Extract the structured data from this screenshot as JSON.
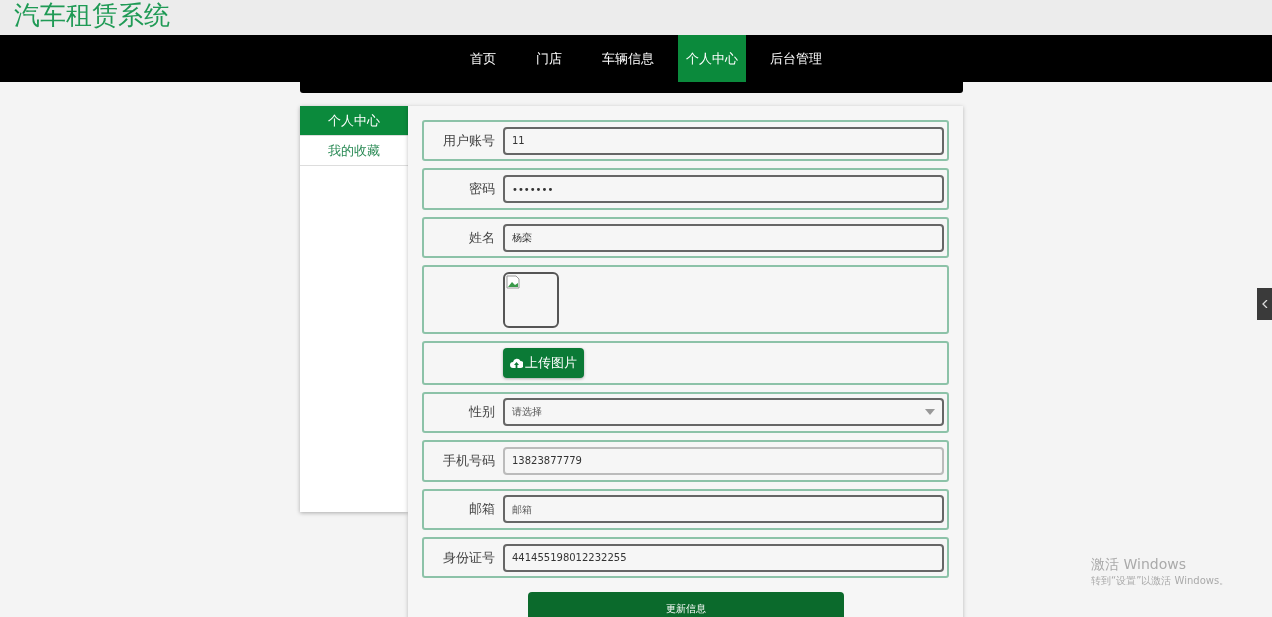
{
  "header": {
    "title": "汽车租赁系统"
  },
  "nav": [
    {
      "label": "首页",
      "selected": false
    },
    {
      "label": "门店",
      "selected": false
    },
    {
      "label": "车辆信息",
      "selected": false
    },
    {
      "label": "个人中心",
      "selected": true
    },
    {
      "label": "后台管理",
      "selected": false
    }
  ],
  "sidebar": {
    "items": [
      {
        "label": "个人中心",
        "selected": true
      },
      {
        "label": "我的收藏",
        "selected": false
      }
    ]
  },
  "form": {
    "fields": [
      {
        "kind": "text",
        "label": "用户账号",
        "value": "11",
        "disabled": false
      },
      {
        "kind": "text",
        "label": "密码",
        "value": "•••••••",
        "disabled": false
      },
      {
        "kind": "text",
        "label": "姓名",
        "value": "杨栾",
        "disabled": false
      },
      {
        "kind": "image"
      },
      {
        "kind": "upload",
        "button": "上传图片"
      },
      {
        "kind": "select",
        "label": "性别",
        "placeholder": "请选择"
      },
      {
        "kind": "text",
        "label": "手机号码",
        "value": "13823877779",
        "disabled": true
      },
      {
        "kind": "text",
        "label": "邮箱",
        "placeholder": "邮箱",
        "disabled": false
      },
      {
        "kind": "text",
        "label": "身份证号",
        "value": "441455198012232255",
        "disabled": false
      }
    ],
    "submit": "更新信息"
  },
  "os_overlay": {
    "title": "激活 Windows",
    "hint": "转到“设置”以激活 Windows。"
  }
}
